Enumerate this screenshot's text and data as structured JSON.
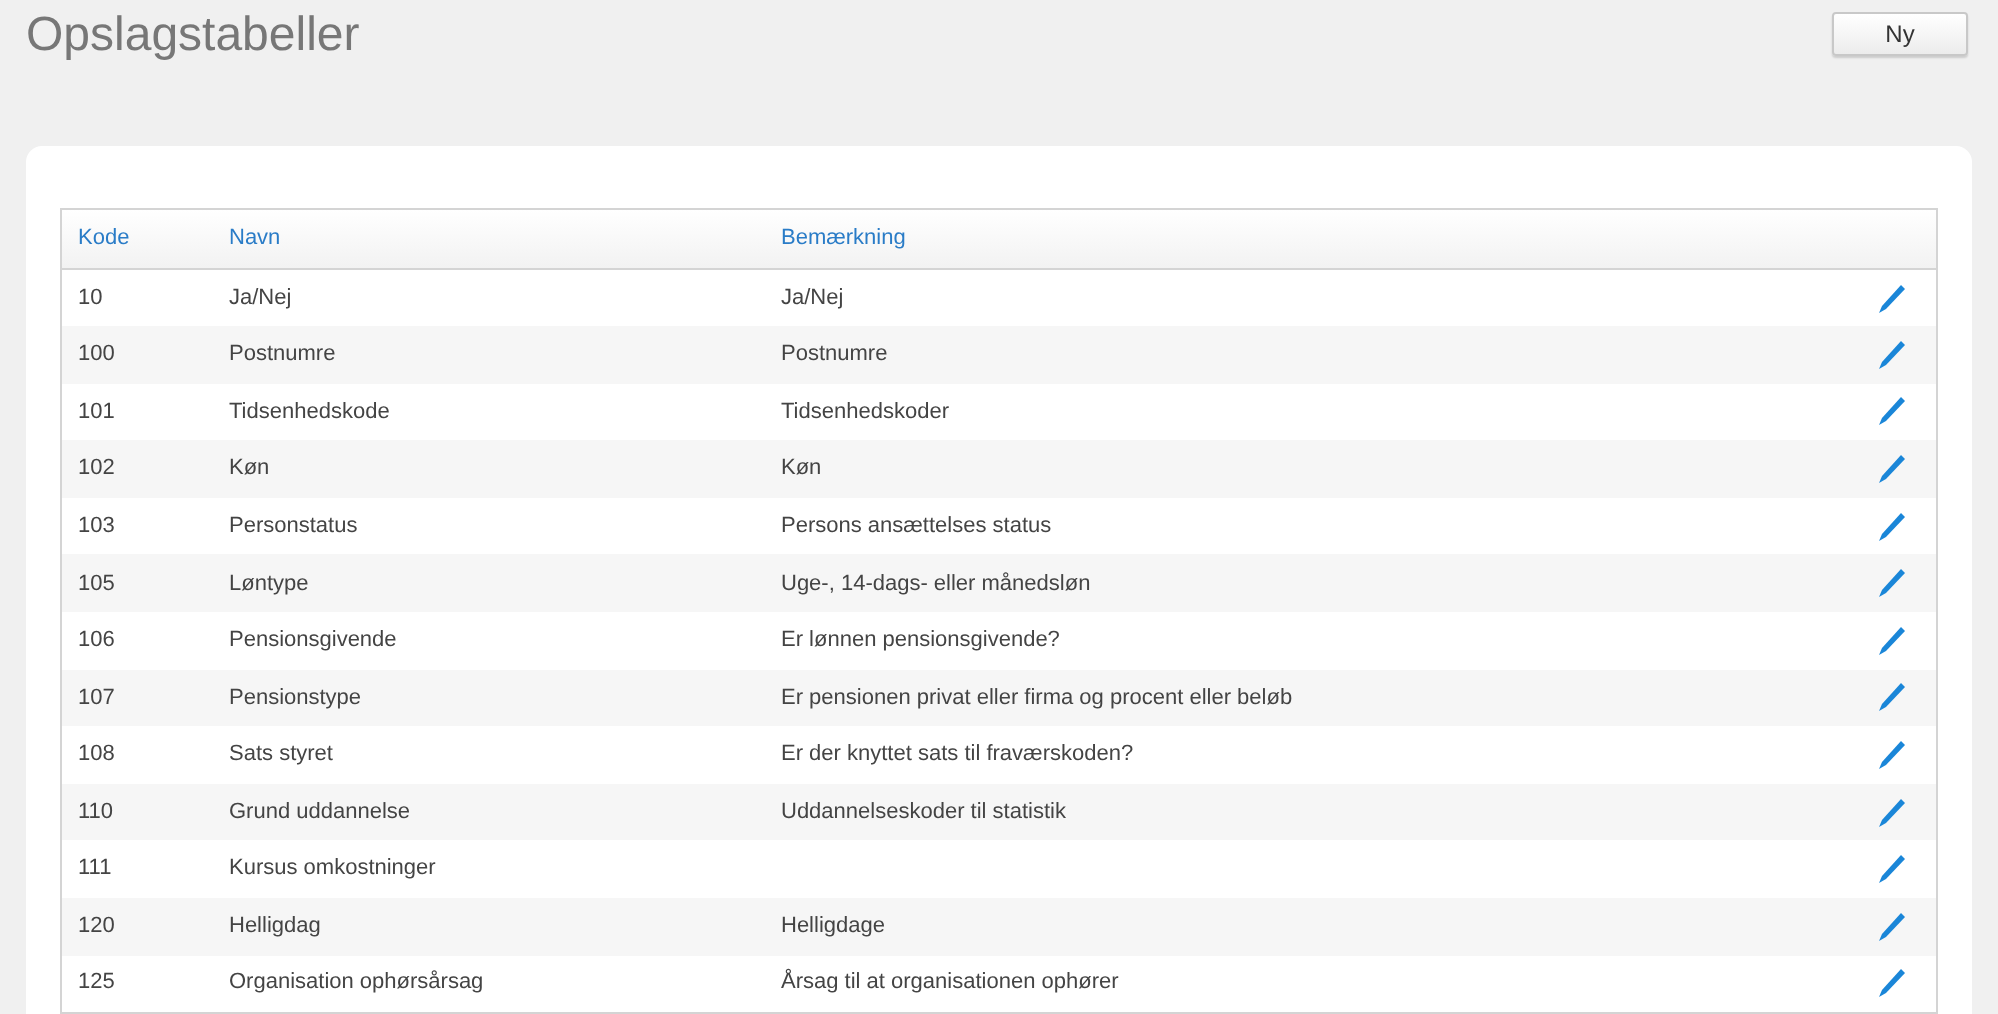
{
  "page_title": "Opslagstabeller",
  "new_button": "Ny",
  "table": {
    "columns": [
      "Kode",
      "Navn",
      "Bemærkning"
    ],
    "rows": [
      {
        "code": "10",
        "name": "Ja/Nej",
        "remark": "Ja/Nej"
      },
      {
        "code": "100",
        "name": "Postnumre",
        "remark": "Postnumre"
      },
      {
        "code": "101",
        "name": "Tidsenhedskode",
        "remark": "Tidsenhedskoder"
      },
      {
        "code": "102",
        "name": "Køn",
        "remark": "Køn"
      },
      {
        "code": "103",
        "name": "Personstatus",
        "remark": "Persons ansættelses status"
      },
      {
        "code": "105",
        "name": "Løntype",
        "remark": "Uge-, 14-dags- eller månedsløn"
      },
      {
        "code": "106",
        "name": "Pensionsgivende",
        "remark": "Er lønnen pensionsgivende?"
      },
      {
        "code": "107",
        "name": "Pensionstype",
        "remark": "Er pensionen privat eller firma og procent eller beløb"
      },
      {
        "code": "108",
        "name": "Sats styret",
        "remark": "Er der knyttet sats til fraværskoden?"
      },
      {
        "code": "110",
        "name": "Grund uddannelse",
        "remark": "Uddannelseskoder til statistik"
      },
      {
        "code": "111",
        "name": "Kursus omkostninger"
      },
      {
        "code": "120",
        "name": "Helligdag",
        "remark": "Helligdage"
      },
      {
        "code": "125",
        "name": "Organisation ophørsårsag",
        "remark": "Årsag til at organisationen ophører"
      }
    ]
  }
}
